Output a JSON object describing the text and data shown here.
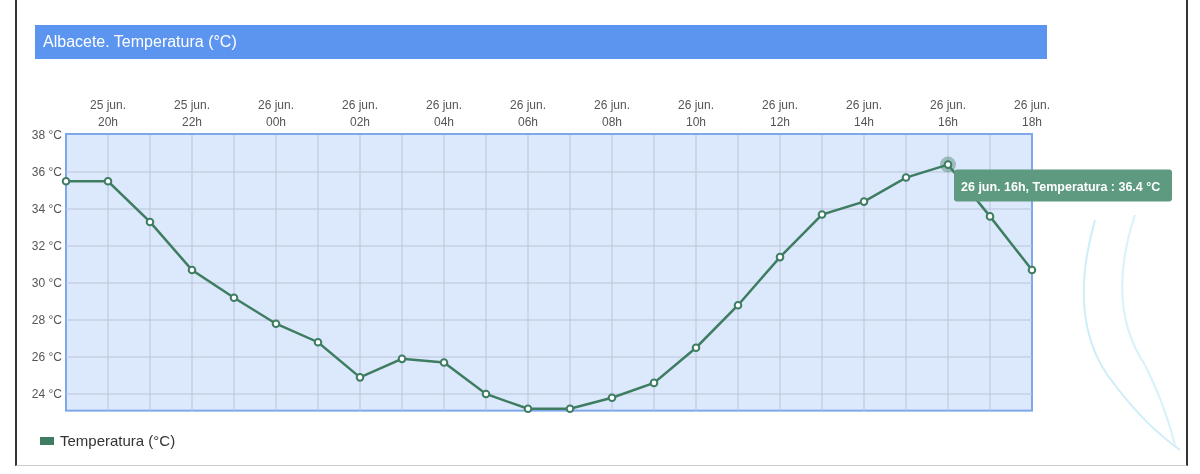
{
  "title": "Albacete. Temperatura (°C)",
  "chart": {
    "chart_data": {
      "type": "line",
      "categories": [
        null,
        "25 jun. 20h",
        null,
        "25 jun. 22h",
        null,
        "26 jun. 00h",
        null,
        "26 jun. 02h",
        null,
        "26 jun. 04h",
        null,
        "26 jun. 06h",
        null,
        "26 jun. 08h",
        null,
        "26 jun. 10h",
        null,
        "26 jun. 12h",
        null,
        "26 jun. 14h",
        null,
        "26 jun. 16h",
        null,
        "26 jun. 18h"
      ],
      "grid": true,
      "series": [
        {
          "name": "Temperatura (°C)",
          "color": "#3e7d62",
          "marker": "circle",
          "values": [
            35.5,
            35.5,
            33.3,
            30.7,
            29.2,
            27.8,
            26.8,
            24.9,
            25.9,
            25.7,
            24.0,
            23.2,
            23.2,
            23.8,
            24.6,
            26.5,
            28.8,
            31.4,
            33.7,
            34.4,
            35.7,
            36.4,
            33.6,
            30.7
          ]
        }
      ],
      "ylim": [
        23.1,
        38
      ],
      "yticks": [
        {
          "value": 24,
          "label": "24 °C"
        },
        {
          "value": 26,
          "label": "26 °C"
        },
        {
          "value": 28,
          "label": "28 °C"
        },
        {
          "value": 30,
          "label": "30 °C"
        },
        {
          "value": 32,
          "label": "32 °C"
        },
        {
          "value": 34,
          "label": "34 °C"
        },
        {
          "value": 36,
          "label": "36 °C"
        },
        {
          "value": 38,
          "label": "38 °C"
        }
      ],
      "annotations": [
        "26 jun. 16h, Temperatura : 36.4 °C"
      ]
    }
  }
}
